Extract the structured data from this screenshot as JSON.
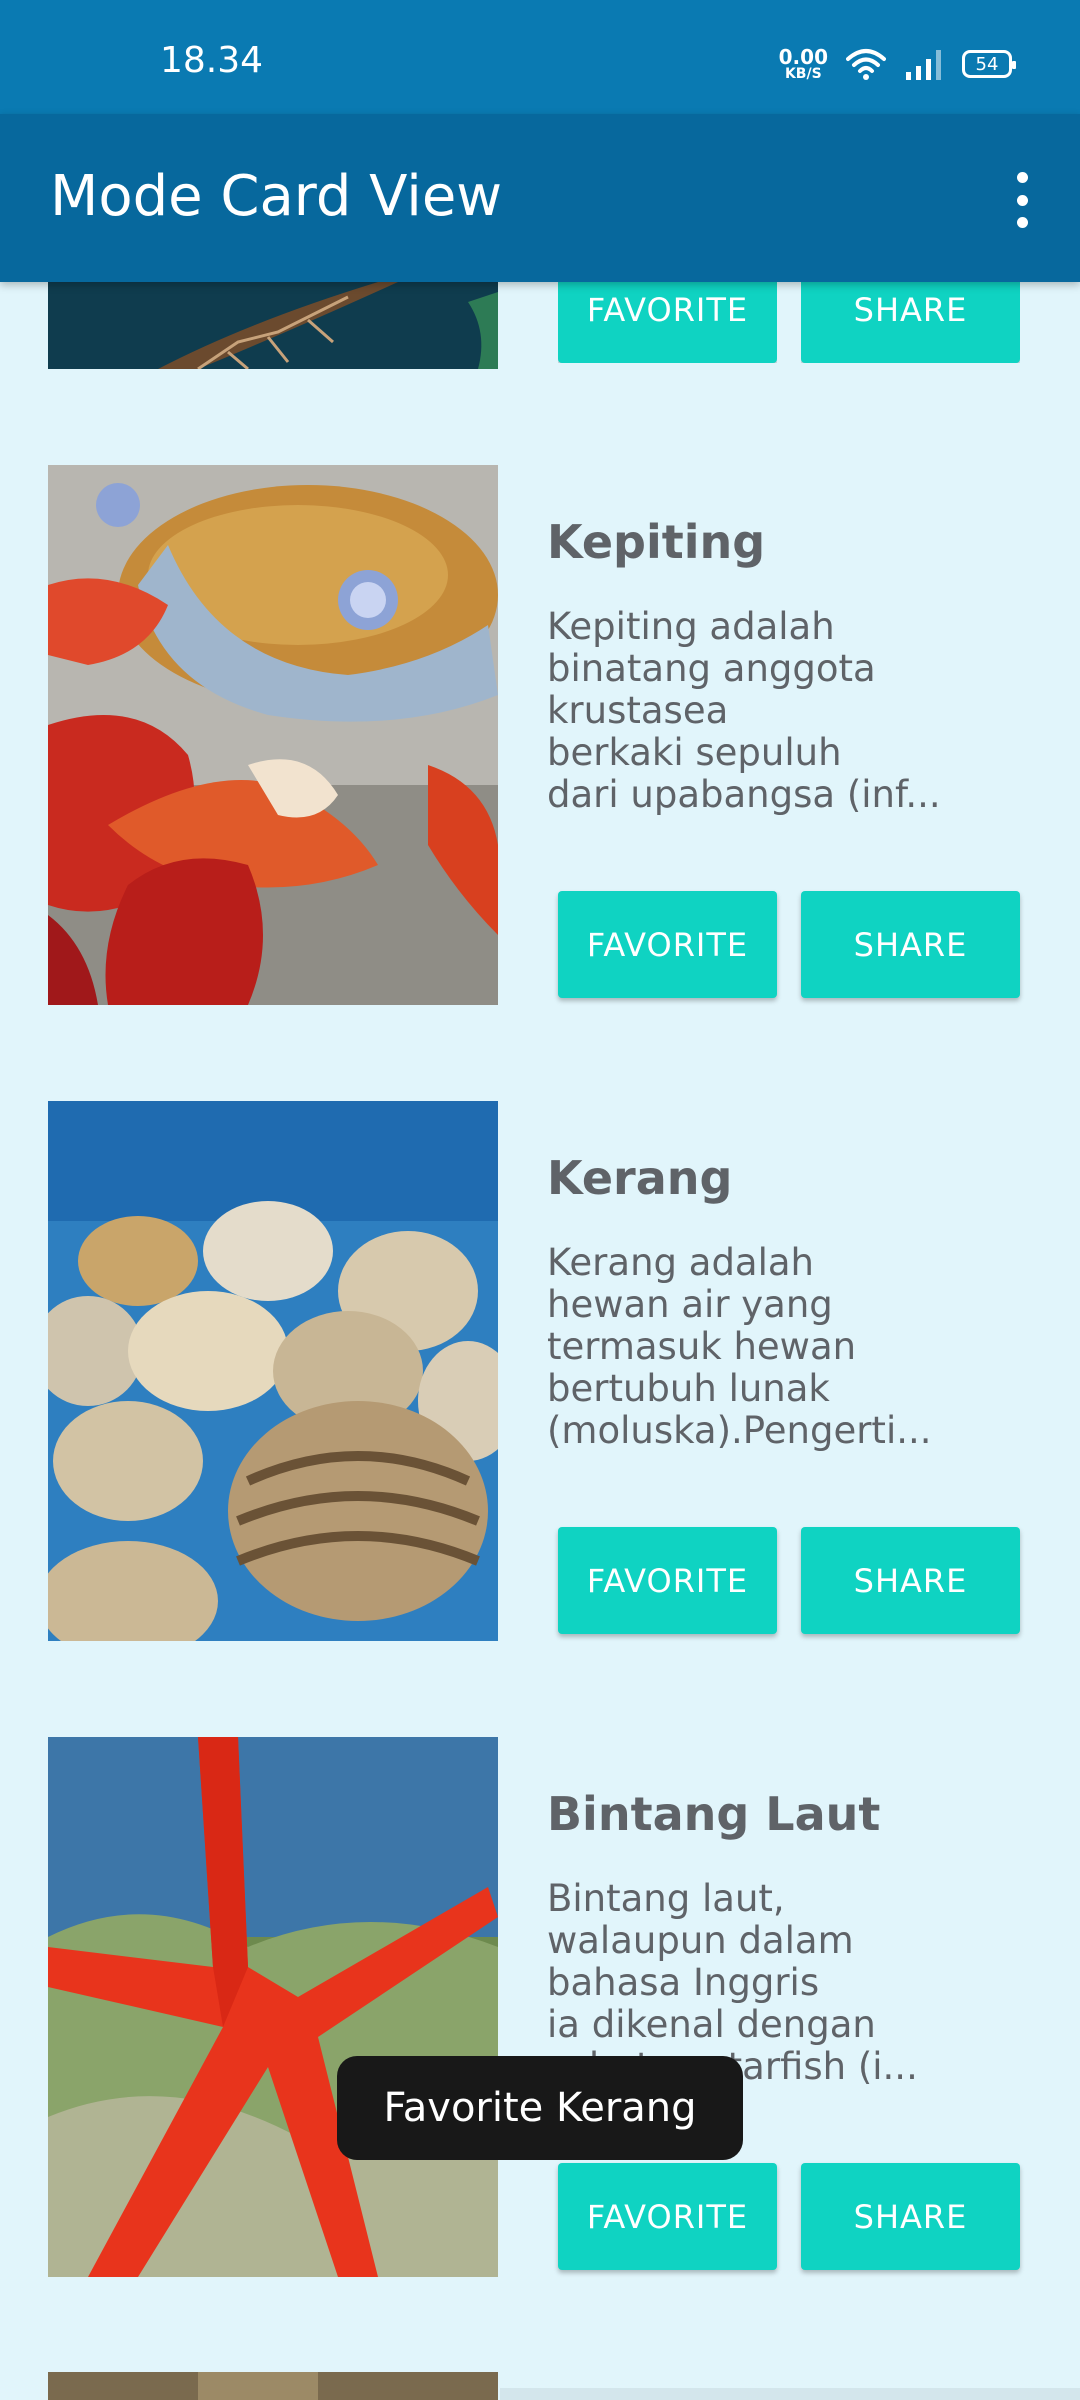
{
  "status_bar": {
    "time": "18.34",
    "net_speed_value": "0.00",
    "net_speed_unit": "KB/S",
    "battery": "54"
  },
  "app_bar": {
    "title": "Mode Card View"
  },
  "buttons": {
    "favorite": "FAVORITE",
    "share": "SHARE"
  },
  "cards": [
    {
      "title": "",
      "description": "",
      "favorite_label": "FAVORITE",
      "share_label": "SHARE"
    },
    {
      "title": "Kepiting",
      "description": "Kepiting adalah\nbinatang anggota\nkrustasea\nberkaki sepuluh\ndari upabangsa (inf...",
      "favorite_label": "FAVORITE",
      "share_label": "SHARE"
    },
    {
      "title": "Kerang",
      "description": "Kerang adalah\nhewan air yang\ntermasuk hewan\nbertubuh lunak\n(moluska).Pengerti...",
      "favorite_label": "FAVORITE",
      "share_label": "SHARE"
    },
    {
      "title": "Bintang Laut",
      "description": "Bintang laut,\nwalaupun dalam\nbahasa Inggris\nia dikenal dengan\nsebutan starfish (i...",
      "favorite_label": "FAVORITE",
      "share_label": "SHARE"
    }
  ],
  "toast": {
    "message": "Favorite Kerang"
  },
  "colors": {
    "status_bar": "#0a7ab2",
    "app_bar": "#07689d",
    "background": "#e1f5fb",
    "button": "#0fd3c2",
    "toast": "#181818"
  },
  "icons": [
    "wifi-icon",
    "signal-icon",
    "battery-icon",
    "overflow-menu-icon"
  ]
}
